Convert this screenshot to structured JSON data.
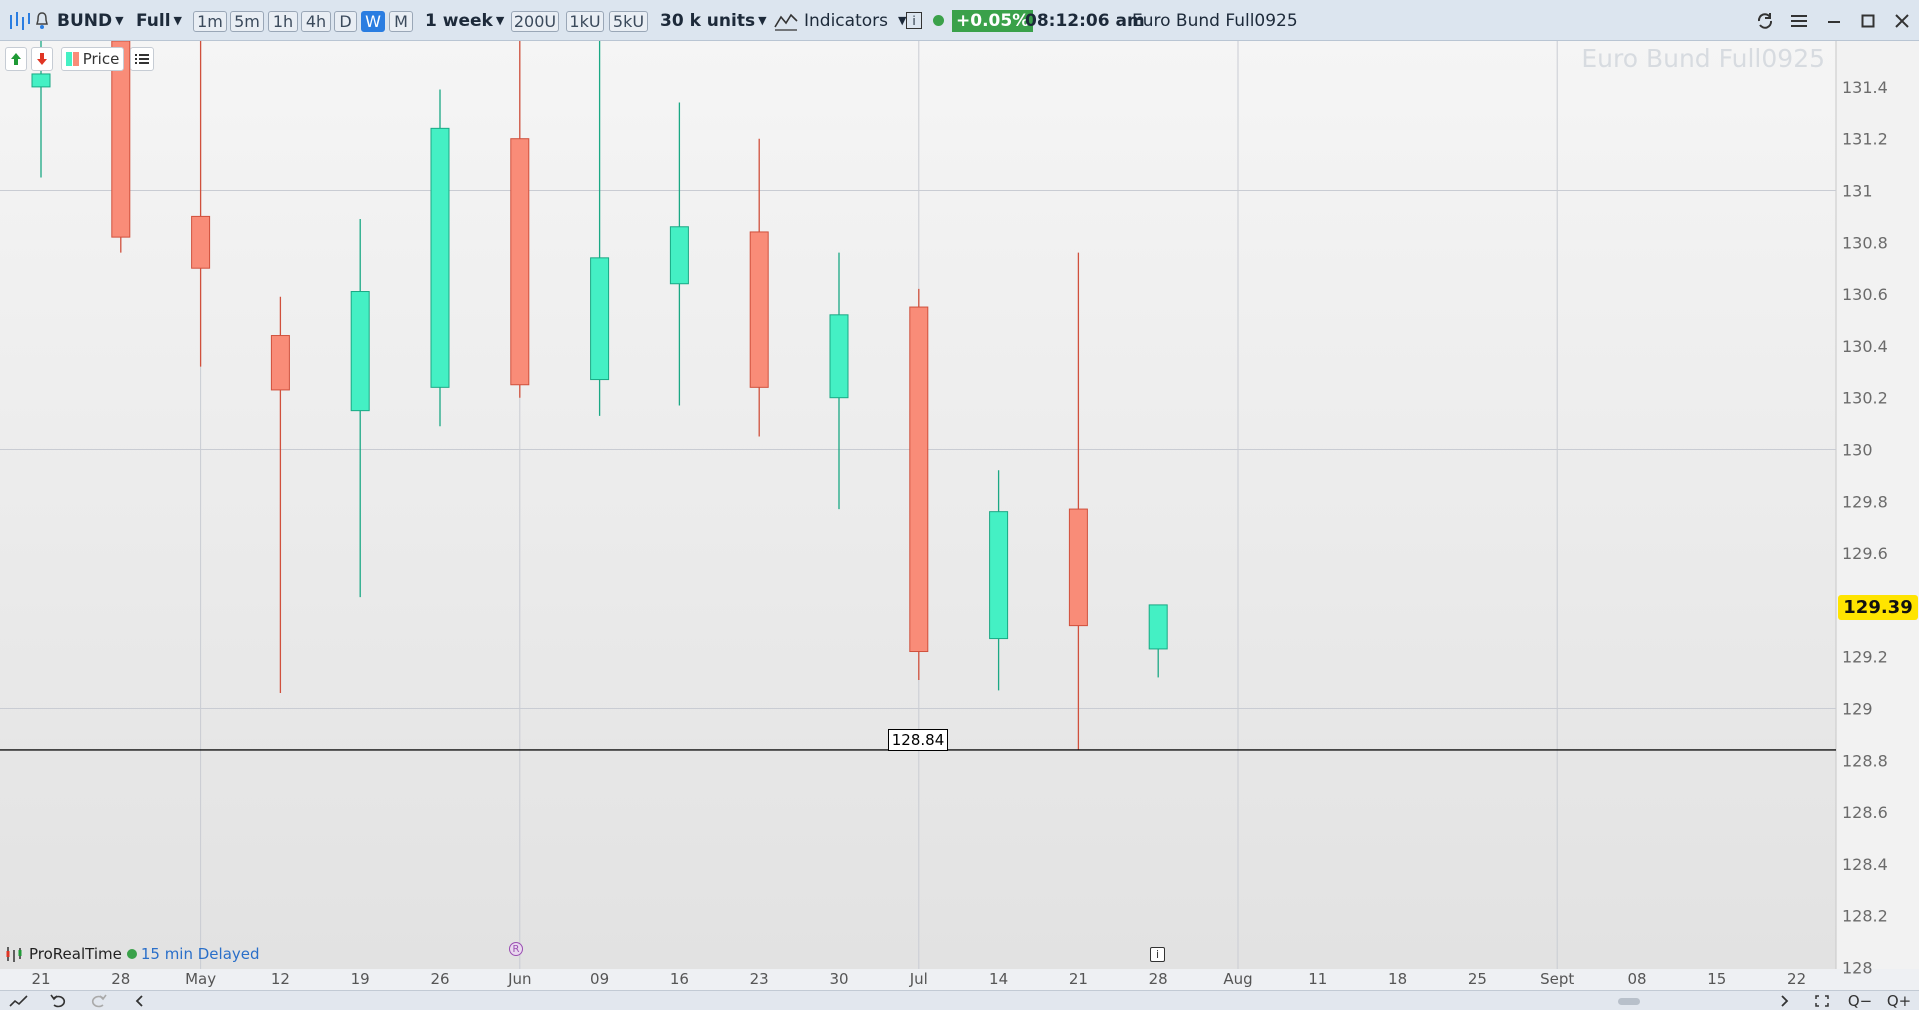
{
  "toolbar": {
    "symbol": "BUND",
    "range": "Full",
    "timeframes": [
      "1m",
      "5m",
      "1h",
      "4h",
      "D",
      "W",
      "M"
    ],
    "selected_timeframe": "W",
    "period": "1 week",
    "units": [
      "200U",
      "1kU",
      "5kU"
    ],
    "units_select": "30 k units",
    "indicators_label": "Indicators",
    "info_label": "i",
    "change": "+0.05%",
    "time": "08:12:06 am",
    "instrument": "Euro Bund Full0925"
  },
  "chart_overlay": {
    "price_button_label": "Price",
    "watermark": "Euro Bund Full0925",
    "last_price_label": "129.39",
    "low_label": "128.84",
    "brand": "ProRealTime",
    "delay": "15 min Delayed",
    "event_r": "R",
    "event_i": "i"
  },
  "chart_data": {
    "type": "candlestick",
    "title": "",
    "xlabel": "",
    "ylabel": "",
    "ylim": [
      128.0,
      131.6
    ],
    "y_ticks": [
      "131.4",
      "131.2",
      "131",
      "130.8",
      "130.6",
      "130.4",
      "130.2",
      "130",
      "129.8",
      "129.6",
      "129.4",
      "129.2",
      "129",
      "128.8",
      "128.6",
      "128.4",
      "128.2",
      "128"
    ],
    "x_tick_labels": [
      "21",
      "28",
      "May",
      "12",
      "19",
      "26",
      "Jun",
      "09",
      "16",
      "23",
      "30",
      "Jul",
      "14",
      "21",
      "28",
      "Aug",
      "11",
      "18",
      "25",
      "Sept",
      "08",
      "15",
      "22"
    ],
    "candles": [
      {
        "x": "21",
        "open": 131.4,
        "high": 131.6,
        "low": 131.05,
        "close": 131.45
      },
      {
        "x": "28",
        "open": 131.6,
        "high": 131.6,
        "low": 130.76,
        "close": 130.82
      },
      {
        "x": "May",
        "open": 130.9,
        "high": 131.6,
        "low": 130.32,
        "close": 130.7
      },
      {
        "x": "12",
        "open": 130.44,
        "high": 130.59,
        "low": 129.06,
        "close": 130.23
      },
      {
        "x": "19",
        "open": 130.15,
        "high": 130.89,
        "low": 129.43,
        "close": 130.61
      },
      {
        "x": "26",
        "open": 130.24,
        "high": 131.39,
        "low": 130.09,
        "close": 131.24
      },
      {
        "x": "Jun",
        "open": 131.2,
        "high": 131.6,
        "low": 130.2,
        "close": 130.25
      },
      {
        "x": "09",
        "open": 130.27,
        "high": 131.6,
        "low": 130.13,
        "close": 130.74
      },
      {
        "x": "16",
        "open": 130.64,
        "high": 131.34,
        "low": 130.17,
        "close": 130.86
      },
      {
        "x": "23",
        "open": 130.84,
        "high": 131.2,
        "low": 130.05,
        "close": 130.24
      },
      {
        "x": "30",
        "open": 130.2,
        "high": 130.76,
        "low": 129.77,
        "close": 130.52
      },
      {
        "x": "Jul",
        "open": 130.55,
        "high": 130.62,
        "low": 129.11,
        "close": 129.22
      },
      {
        "x": "14",
        "open": 129.27,
        "high": 129.92,
        "low": 129.07,
        "close": 129.76
      },
      {
        "x": "21",
        "open": 129.77,
        "high": 130.76,
        "low": 128.84,
        "close": 129.32
      },
      {
        "x": "28",
        "open": 129.23,
        "high": 129.4,
        "low": 129.12,
        "close": 129.4
      }
    ],
    "horizontal_line": 128.84,
    "last_price": 129.39,
    "grid": true,
    "up_color": "#44f0c4",
    "down_color": "#f98c78"
  },
  "bottom_bar": {
    "draw_icon": "pencil-icon",
    "undo_icon": "undo-icon",
    "redo_icon": "redo-icon",
    "scroll_left_icon": "chevron-left-icon",
    "scroll_right_icon": "chevron-right-icon",
    "fullscreen_icon": "fullscreen-icon",
    "zoom_out_label": "Q−",
    "zoom_in_label": "Q+"
  },
  "colors": {
    "toolbar_bg": "#dce5ef",
    "accent": "#2a7de1",
    "last_price_bg": "#ffe400",
    "change_bg": "#3aa14a"
  }
}
